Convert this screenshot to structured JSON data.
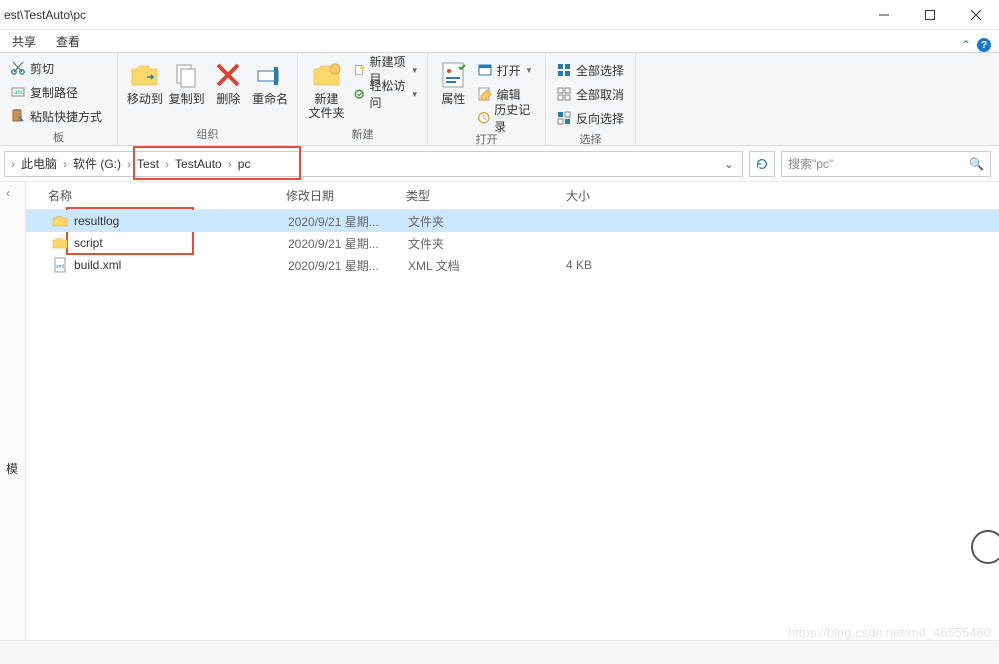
{
  "window": {
    "title_path": "est\\TestAuto\\pc"
  },
  "tabs": {
    "share": "共享",
    "view": "查看"
  },
  "ribbon": {
    "clipboard": {
      "cut": "剪切",
      "copy_path": "复制路径",
      "paste_shortcut": "粘贴快捷方式",
      "group": "板"
    },
    "organize": {
      "move_to": "移动到",
      "copy_to": "复制到",
      "delete": "删除",
      "rename": "重命名",
      "group": "组织"
    },
    "new": {
      "new_folder": "新建\n文件夹",
      "new_item": "新建项目",
      "easy_access": "轻松访问",
      "group": "新建"
    },
    "open": {
      "properties": "属性",
      "open": "打开",
      "edit": "编辑",
      "history": "历史记录",
      "group": "打开"
    },
    "select": {
      "select_all": "全部选择",
      "select_none": "全部取消",
      "invert": "反向选择",
      "group": "选择"
    }
  },
  "breadcrumb": {
    "items": [
      "此电脑",
      "软件 (G:)",
      "Test",
      "TestAuto",
      "pc"
    ]
  },
  "search": {
    "placeholder": "搜索\"pc\""
  },
  "columns": {
    "name": "名称",
    "date": "修改日期",
    "type": "类型",
    "size": "大小"
  },
  "files": [
    {
      "name": "resultlog",
      "date": "2020/9/21 星期...",
      "type": "文件夹",
      "size": "",
      "icon": "folder",
      "selected": true
    },
    {
      "name": "script",
      "date": "2020/9/21 星期...",
      "type": "文件夹",
      "size": "",
      "icon": "folder",
      "selected": false
    },
    {
      "name": "build.xml",
      "date": "2020/9/21 星期...",
      "type": "XML 文档",
      "size": "4 KB",
      "icon": "xml",
      "selected": false
    }
  ],
  "watermark": "https://blog.csdn.net/m0_46555480"
}
